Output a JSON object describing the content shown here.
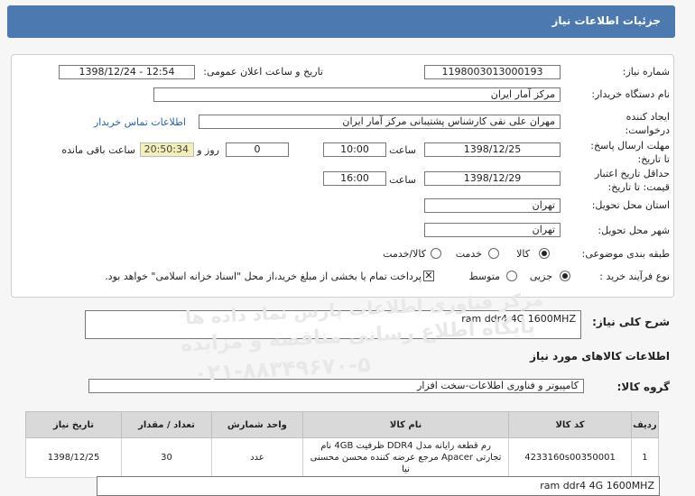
{
  "header": {
    "title": "جزئیات اطلاعات نیاز"
  },
  "form": {
    "need_number_label": "شماره نیاز:",
    "need_number": "1198003013000193",
    "announce_label": "تاریخ و ساعت اعلان عمومی:",
    "announce_value": "1398/12/24 - 12:54",
    "buyer_org_label": "نام دستگاه خریدار:",
    "buyer_org": "مرکز آمار ایران",
    "creator_label": "ایجاد کننده درخواست:",
    "creator": "مهران  علی نقی کارشناس پشتیبانی مرکز آمار ایران",
    "contact_link": "اطلاعات تماس خریدار",
    "send_deadline_label": "مهلت ارسال پاسخ: تا تاریخ:",
    "send_date": "1398/12/25",
    "time_label": "ساعت",
    "send_time": "10:00",
    "days_value": "0",
    "days_label": "روز و",
    "remaining_time": "20:50:34",
    "remaining_label": "ساعت باقی مانده",
    "validity_label": "حداقل تاریخ اعتبار قیمت: تا تاریخ:",
    "validity_date": "1398/12/29",
    "validity_time": "16:00",
    "province_label": "استان محل تحویل:",
    "province": "تهران",
    "city_label": "شهر محل تحویل:",
    "city": "تهران",
    "category_label": "طبقه بندی موضوعی:",
    "category_options": [
      "کالا",
      "خدمت",
      "کالا/خدمت"
    ],
    "category_selected": "کالا",
    "process_label": "نوع فرآیند خرید :",
    "process_options": [
      "جزیی",
      "متوسط"
    ],
    "process_selected": "جزیی",
    "payment_note": "پرداخت تمام یا بخشی از مبلغ خرید،از محل \"اسناد خزانه اسلامی\" خواهد بود."
  },
  "description": {
    "label": "شرح کلی نیاز:",
    "value": "ram ddr4 4G 1600MHZ"
  },
  "goods_section": {
    "title": "اطلاعات کالاهای مورد نیاز"
  },
  "goods_group": {
    "label": "گروه کالا:",
    "value": "کامپیوتر و فناوری اطلاعات-سخت افزار"
  },
  "table": {
    "headers": [
      "ردیف",
      "کد کالا",
      "نام کالا",
      "واحد شمارش",
      "تعداد / مقدار",
      "تاریخ نیاز"
    ],
    "rows": [
      {
        "row": "1",
        "code": "4233160s00350001",
        "name": "رم قطعه رایانه مدل DDR4 ظرفیت 4GB نام تجارتی Apacer مرجع عرضه کننده محسن محسنی نیا",
        "unit": "عدد",
        "qty": "30",
        "date": "1398/12/25"
      }
    ]
  },
  "footer_note": {
    "value": "ram ddr4 4G 1600MHZ"
  },
  "watermark": {
    "line1": "مرکز فناوری اطلاعات پارس نماد داده ها",
    "line2": "پایگاه اطلاع رسانی مناقصه و مزایده",
    "line3": "۰۲۱-۸۸۳۴۹۶۷۰-۵"
  }
}
